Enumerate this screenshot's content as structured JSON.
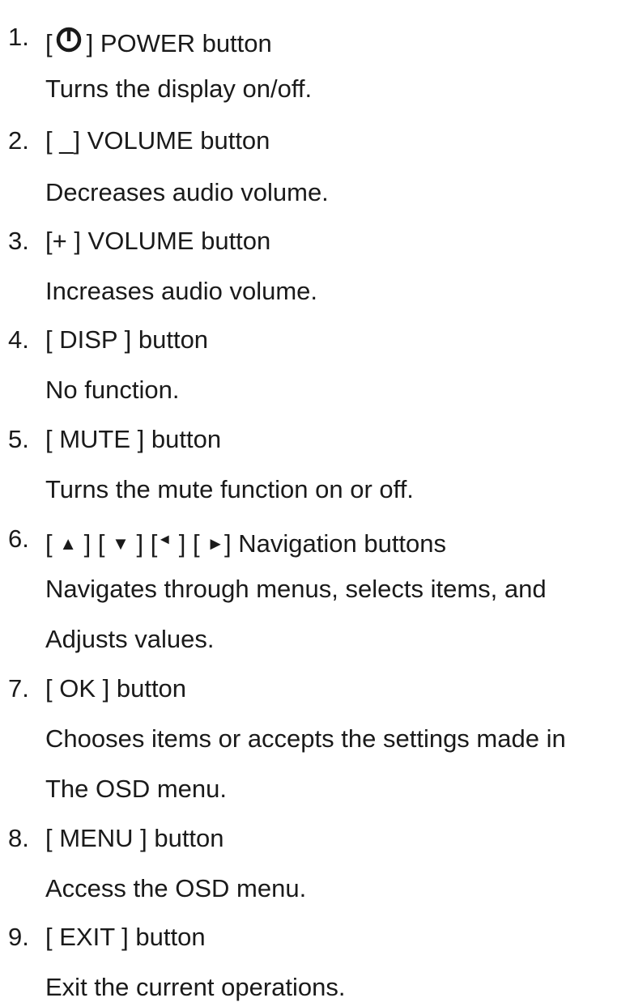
{
  "items": [
    {
      "number": "1.",
      "label_before": "[",
      "label_after": "] POWER button",
      "icon": "power-icon",
      "description": [
        "Turns the display on/off."
      ]
    },
    {
      "number": "2.",
      "label": "[ _] VOLUME button",
      "description": [
        "Decreases audio volume."
      ]
    },
    {
      "number": "3.",
      "label": "[+ ] VOLUME button",
      "description": [
        "Increases audio volume."
      ]
    },
    {
      "number": "4.",
      "label": "[ DISP ] button",
      "description": [
        "No function."
      ]
    },
    {
      "number": "5.",
      "label": "[ MUTE ] button",
      "description": [
        "Turns the mute function on or off."
      ]
    },
    {
      "number": "6.",
      "nav_parts": [
        "[ ",
        "▲",
        " ] [ ",
        "▼",
        " ] [",
        "◄",
        " ] [ ",
        "►",
        "] Navigation buttons"
      ],
      "description": [
        "Navigates through menus, selects items, and",
        "Adjusts values."
      ]
    },
    {
      "number": "7.",
      "label": "[ OK ] button",
      "description": [
        "Chooses items or accepts the settings made in",
        "The OSD menu."
      ]
    },
    {
      "number": "8.",
      "label": "[ MENU ] button",
      "description": [
        "Access the OSD menu."
      ]
    },
    {
      "number": "9.",
      "label": "[ EXIT ] button",
      "description": [
        "Exit the current operations."
      ]
    }
  ]
}
